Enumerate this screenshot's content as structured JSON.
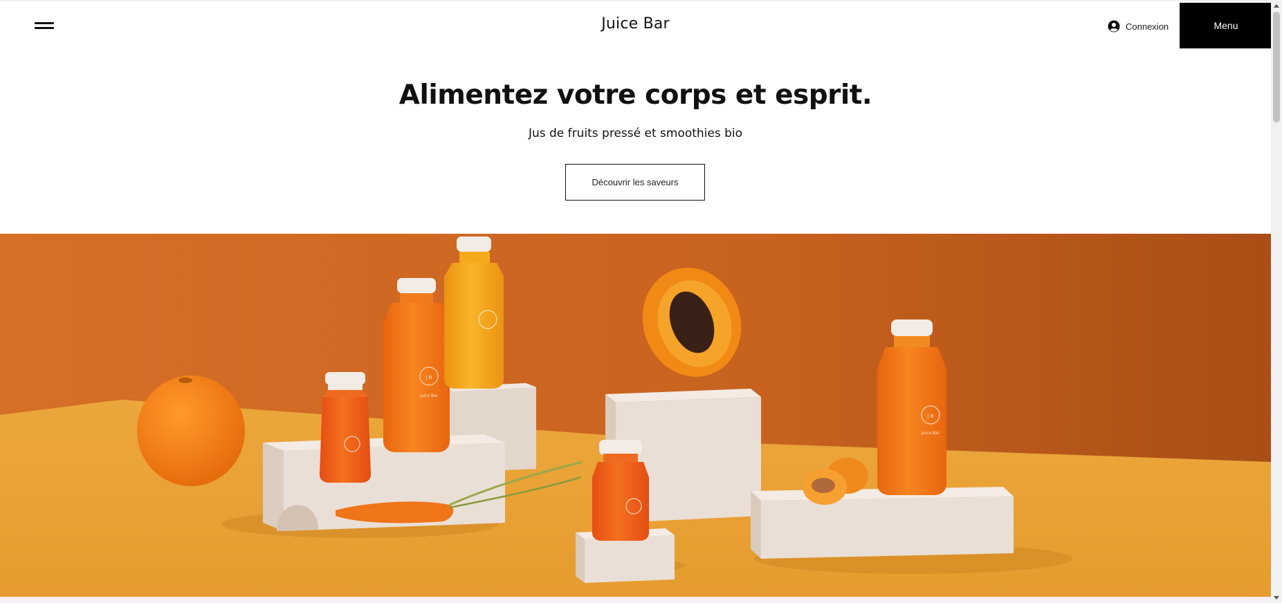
{
  "header": {
    "brand": "Juice Bar",
    "login_label": "Connexion",
    "menu_label": "Menu",
    "login_icon": "user-circle-icon",
    "hamburger_icon": "hamburger-menu-icon"
  },
  "hero": {
    "title": "Alimentez votre corps et esprit.",
    "subtitle": "Jus de fruits pressé et smoothies bio",
    "cta_label": "Découvrir les saveurs"
  },
  "image": {
    "bottle_label": "Juice Bar",
    "bottle_monogram": "J B"
  },
  "colors": {
    "wall": "#c8621f",
    "floor": "#e9a23a",
    "pedestal": "#eadfd6",
    "bottle_orange": "#f07a1c",
    "bottle_yellow": "#f5a91d",
    "cap": "#f3ece5",
    "menu_button_bg": "#000000"
  }
}
